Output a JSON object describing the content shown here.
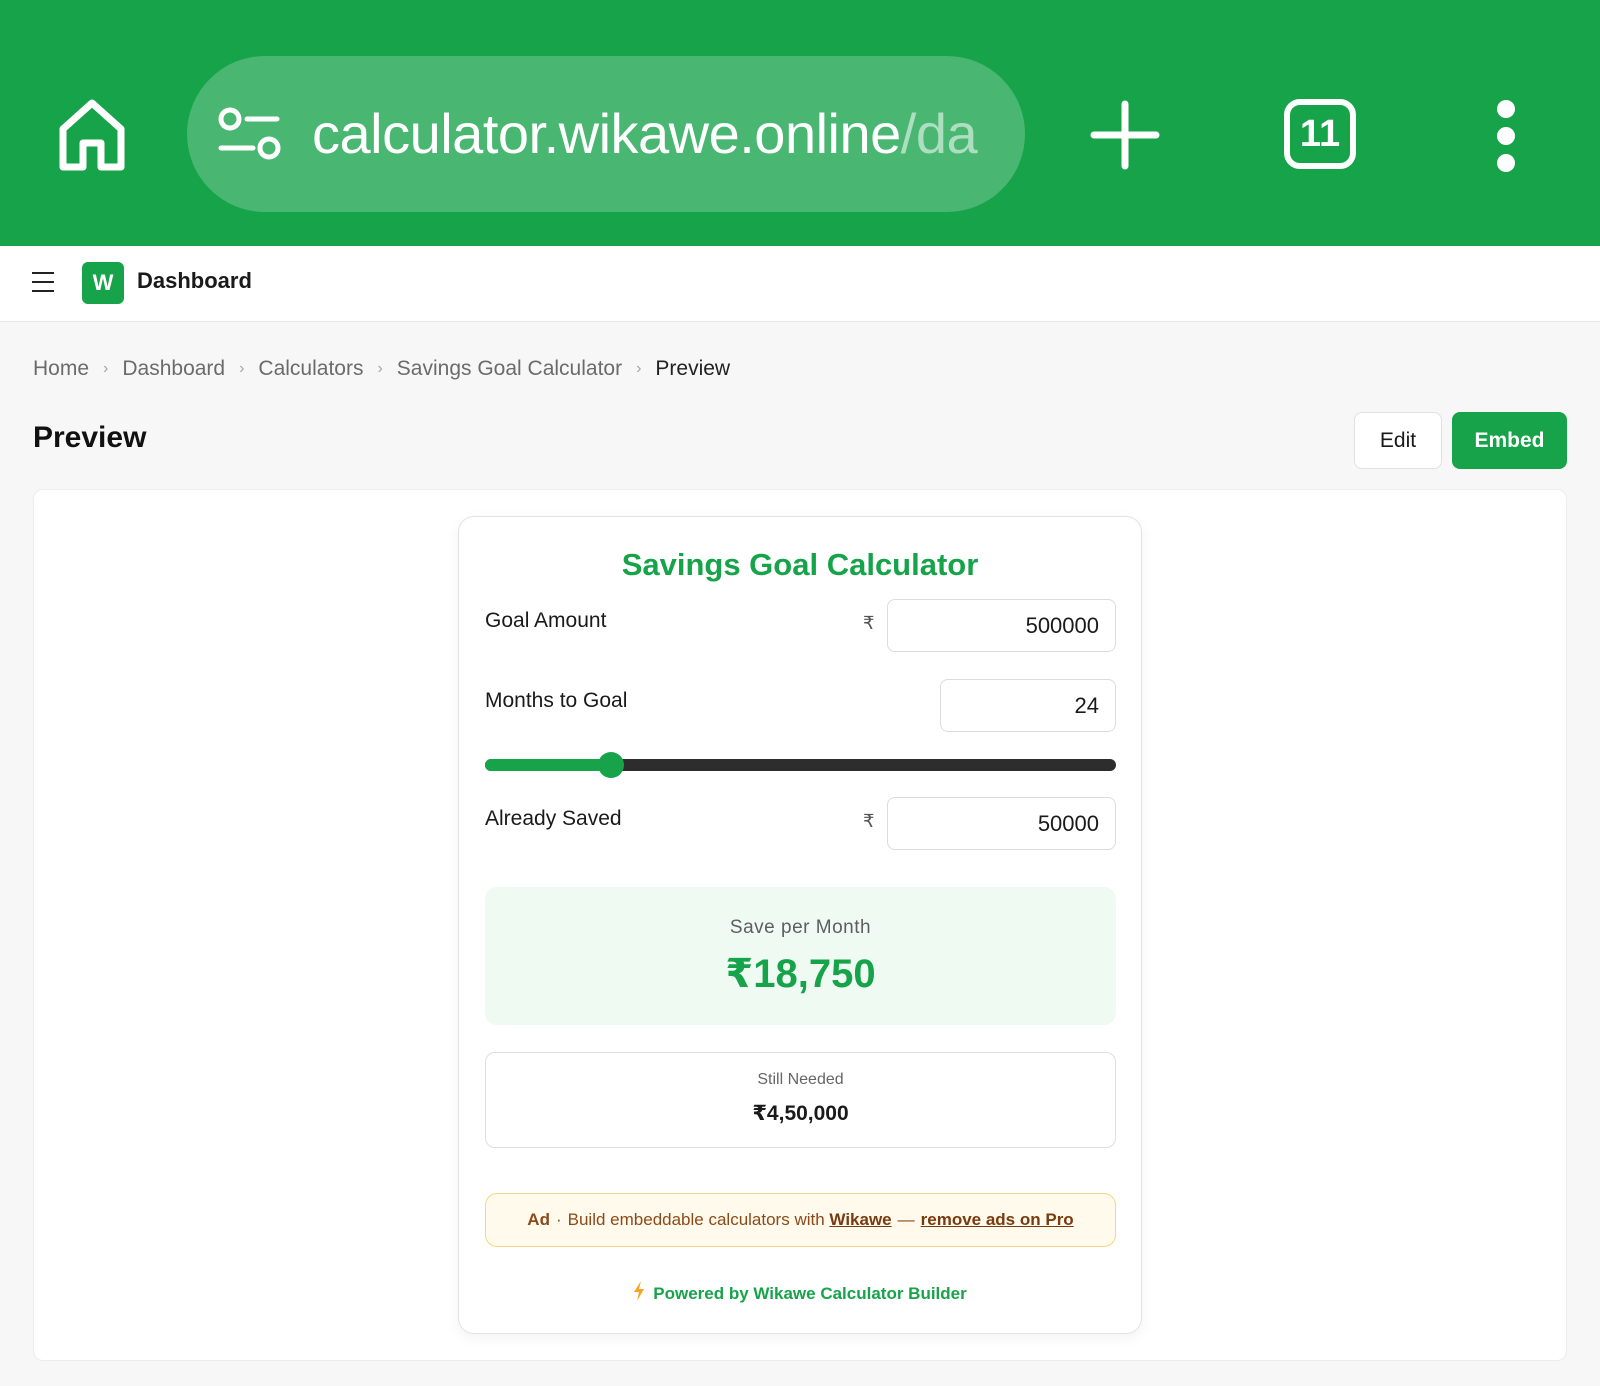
{
  "browser": {
    "url_host": "calculator.wikawe.online",
    "url_path": "/da",
    "tab_count": "11"
  },
  "app": {
    "logo_letter": "W",
    "title": "Dashboard"
  },
  "breadcrumb": [
    {
      "label": "Home"
    },
    {
      "label": "Dashboard"
    },
    {
      "label": "Calculators"
    },
    {
      "label": "Savings Goal Calculator"
    },
    {
      "label": "Preview"
    }
  ],
  "page": {
    "title": "Preview",
    "edit_label": "Edit",
    "embed_label": "Embed"
  },
  "calculator": {
    "title": "Savings Goal Calculator",
    "currency_symbol": "₹",
    "goal_amount": {
      "label": "Goal Amount",
      "value": "500000"
    },
    "months": {
      "label": "Months to Goal",
      "value": "24",
      "slider_fraction": 0.2
    },
    "already_saved": {
      "label": "Already Saved",
      "value": "50000"
    },
    "result": {
      "label": "Save per Month",
      "value": "₹18,750"
    },
    "still_needed": {
      "label": "Still Needed",
      "value": "₹4,50,000"
    },
    "ad": {
      "tag": "Ad",
      "dot": "·",
      "text": "Build embeddable calculators with",
      "link": "Wikawe",
      "dash": "—",
      "pro_link": "remove ads on Pro"
    },
    "powered_by": "Powered by Wikawe Calculator Builder"
  },
  "colors": {
    "brand_green": "#17a34a",
    "result_bg": "#effbf2",
    "ad_bg": "#fffaeb"
  }
}
